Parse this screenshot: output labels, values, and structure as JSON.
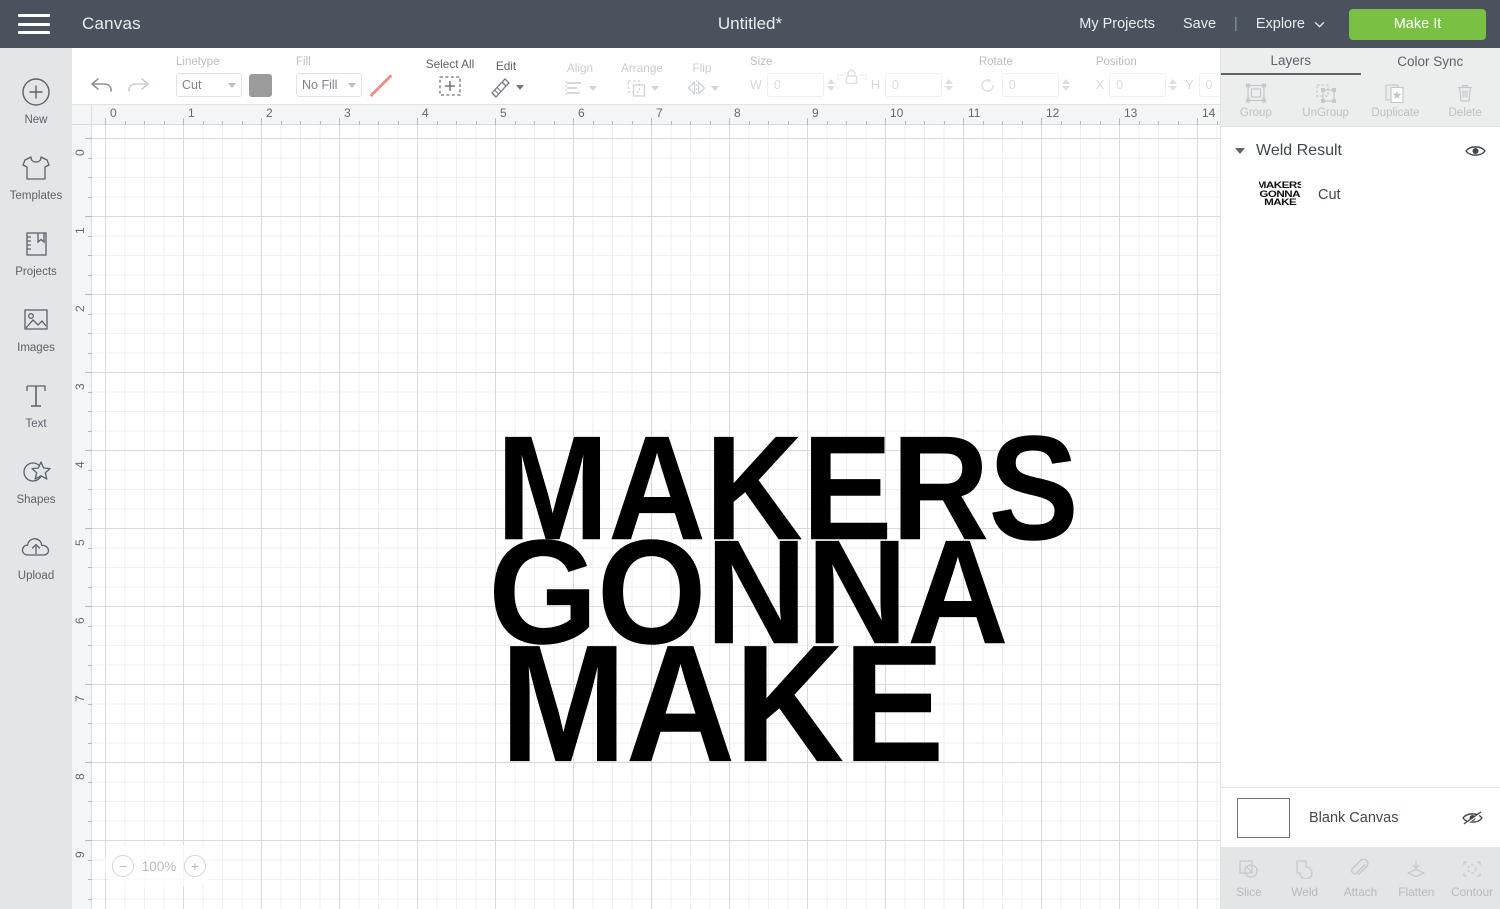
{
  "header": {
    "menu_icon": "hamburger-icon",
    "app_name": "Canvas",
    "document_title": "Untitled*",
    "my_projects": "My Projects",
    "save": "Save",
    "separator": "|",
    "machine": "Explore",
    "machine_caret": "chevron-down-icon",
    "make_it": "Make It",
    "bg_color": "#4a535d",
    "make_it_color": "#7ac143"
  },
  "sidebar": {
    "items": [
      {
        "label": "New",
        "icon": "plus-circle-icon"
      },
      {
        "label": "Templates",
        "icon": "tshirt-icon"
      },
      {
        "label": "Projects",
        "icon": "book-icon"
      },
      {
        "label": "Images",
        "icon": "image-icon"
      },
      {
        "label": "Text",
        "icon": "text-t-icon"
      },
      {
        "label": "Shapes",
        "icon": "shapes-icon"
      },
      {
        "label": "Upload",
        "icon": "upload-cloud-icon"
      }
    ]
  },
  "toolbar": {
    "undo": "undo-icon",
    "redo": "redo-icon",
    "linetype": {
      "label": "Linetype",
      "value": "Cut",
      "swatch_color": "#9b9b9b"
    },
    "fill": {
      "label": "Fill",
      "value": "No Fill",
      "swatch": "no-fill-slash"
    },
    "select_all": "Select All",
    "edit": "Edit",
    "align": "Align",
    "arrange": "Arrange",
    "flip": "Flip",
    "size": {
      "label": "Size",
      "w_label": "W",
      "w_value": "0",
      "h_label": "H",
      "h_value": "0",
      "lock": "lock-icon"
    },
    "rotate": {
      "label": "Rotate",
      "value": "0"
    },
    "position": {
      "label": "Position",
      "x_label": "X",
      "x_value": "0",
      "y_label": "Y",
      "y_value": "0"
    }
  },
  "canvas": {
    "h_ruler": [
      "0",
      "1",
      "2",
      "3",
      "4",
      "5",
      "6",
      "7",
      "8",
      "9",
      "10",
      "11",
      "12",
      "13",
      "14"
    ],
    "v_ruler": [
      "0",
      "1",
      "2",
      "3",
      "4",
      "5",
      "6",
      "7",
      "8",
      "9"
    ],
    "zoom": {
      "level": "100%",
      "minus": "−",
      "plus": "+"
    },
    "artwork": {
      "line1": "MAKERS",
      "line2": "GONNA",
      "line3": "MAKE",
      "color": "#000000"
    }
  },
  "right_panel": {
    "tabs": [
      {
        "label": "Layers",
        "active": true
      },
      {
        "label": "Color Sync",
        "active": false
      }
    ],
    "tools": [
      {
        "label": "Group",
        "icon": "group-icon"
      },
      {
        "label": "UnGroup",
        "icon": "ungroup-icon"
      },
      {
        "label": "Duplicate",
        "icon": "duplicate-icon"
      },
      {
        "label": "Delete",
        "icon": "trash-icon"
      }
    ],
    "layer_group": {
      "name": "Weld Result",
      "collapse_icon": "triangle-down-icon",
      "visibility_icon": "eye-icon"
    },
    "layer": {
      "type": "Cut",
      "thumb_line1": "MAKERS",
      "thumb_line2": "GONNA",
      "thumb_line3": "MAKE"
    },
    "blank_canvas": {
      "label": "Blank Canvas",
      "visibility_icon": "eye-off-icon"
    },
    "bottom_tools": [
      {
        "label": "Slice",
        "icon": "slice-icon"
      },
      {
        "label": "Weld",
        "icon": "weld-icon"
      },
      {
        "label": "Attach",
        "icon": "paperclip-icon"
      },
      {
        "label": "Flatten",
        "icon": "flatten-icon"
      },
      {
        "label": "Contour",
        "icon": "contour-icon"
      }
    ]
  }
}
